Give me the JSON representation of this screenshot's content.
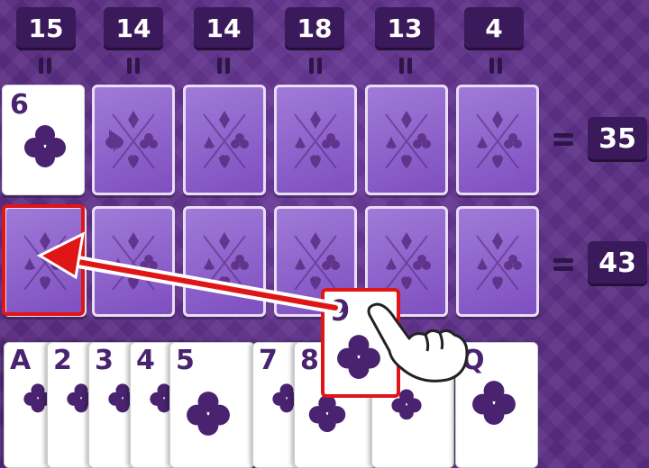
{
  "column_sums": [
    "15",
    "14",
    "14",
    "18",
    "13",
    "4"
  ],
  "row_sums": [
    "35",
    "43"
  ],
  "board_face_up_card": {
    "rank": "6",
    "suit": "club-icon"
  },
  "dragged_card": {
    "rank": "9",
    "suit": "club-icon"
  },
  "hand_cards": [
    "A",
    "2",
    "3",
    "4",
    "5",
    "7",
    "8",
    "10",
    "Q"
  ],
  "colors": {
    "background": "#5a2d82",
    "card_back": "#8f63cc",
    "highlight": "#e01515",
    "ink": "#4a2370"
  }
}
